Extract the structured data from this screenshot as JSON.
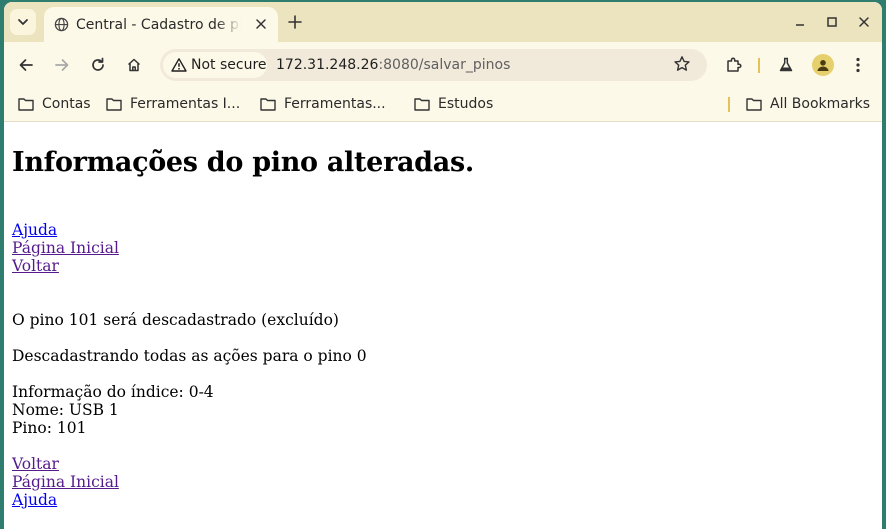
{
  "browser": {
    "tab": {
      "title": "Central - Cadastro de pinos"
    },
    "address": {
      "security_label": "Not secure",
      "url_host": "172.31.248.26",
      "url_rest": ":8080/salvar_pinos"
    },
    "bookmarks": [
      {
        "label": "Contas"
      },
      {
        "label": "Ferramentas I..."
      },
      {
        "label": "Ferramentas..."
      },
      {
        "label": "Estudos"
      }
    ],
    "all_bookmarks_label": "All Bookmarks"
  },
  "page": {
    "heading": "Informações do pino alteradas.",
    "top_links": [
      {
        "label": "Ajuda"
      },
      {
        "label": "Página Inicial"
      },
      {
        "label": "Voltar"
      }
    ],
    "messages": {
      "removed": "O pino 101 será descadastrado (excluído)",
      "actions": "Descadastrando todas as ações para o pino 0",
      "index_info": "Informação do índice: 0-4",
      "name": "Nome: USB 1",
      "pin": "Pino: 101"
    },
    "bottom_links": [
      {
        "label": "Voltar"
      },
      {
        "label": "Página Inicial"
      },
      {
        "label": "Ajuda"
      }
    ]
  },
  "colors": {
    "link": "#0000ee",
    "link_visited": "#551a8b",
    "tabstrip": "#ece3bf",
    "toolbar": "#fdf9e9"
  }
}
